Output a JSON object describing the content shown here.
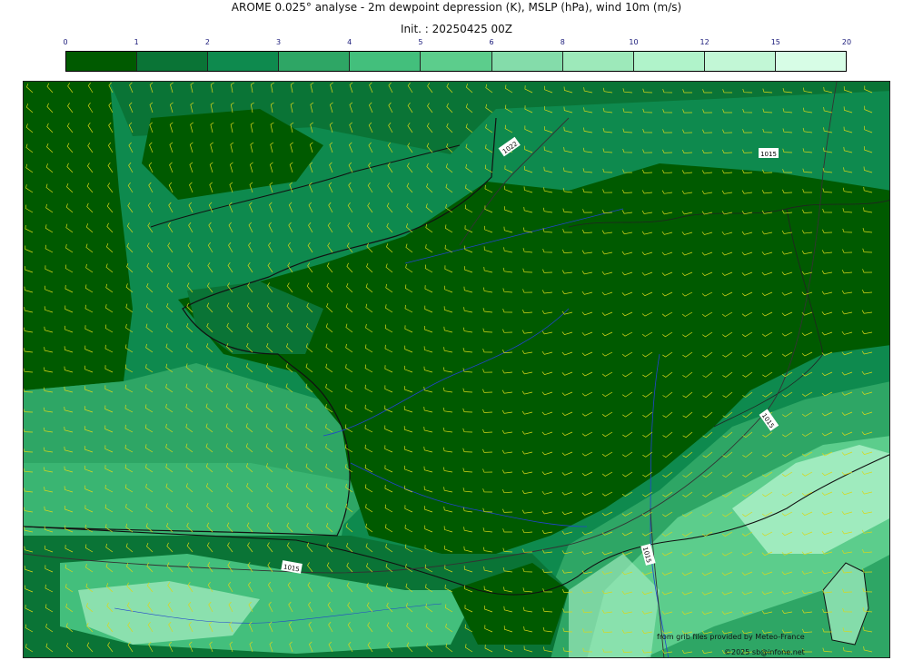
{
  "title": "AROME 0.025° analyse - 2m dewpoint depression (K), MSLP (hPa), wind 10m (m/s)",
  "init": "Init. : 20250425 00Z",
  "colorbar": {
    "ticks": [
      "0",
      "1",
      "2",
      "3",
      "4",
      "5",
      "6",
      "8",
      "10",
      "12",
      "15",
      "20"
    ],
    "colors": [
      "#005a00",
      "#0a7436",
      "#0e8a4e",
      "#2ea665",
      "#43bf7c",
      "#5ccd8c",
      "#84dcaa",
      "#9de9ba",
      "#b0f3ca",
      "#c2f7d6",
      "#d7fde6"
    ]
  },
  "map": {
    "isobar_labels": [
      "1022",
      "1015",
      "1015",
      "1015",
      "1015"
    ],
    "colors": {
      "coast": "#111111",
      "river": "#2244cc",
      "wind_barb": "#d8d81a",
      "isobar": "#333333"
    }
  },
  "credits": {
    "line1": "from grib files provided by Meteo-France",
    "line2": "©2025 sb@infone.net"
  }
}
